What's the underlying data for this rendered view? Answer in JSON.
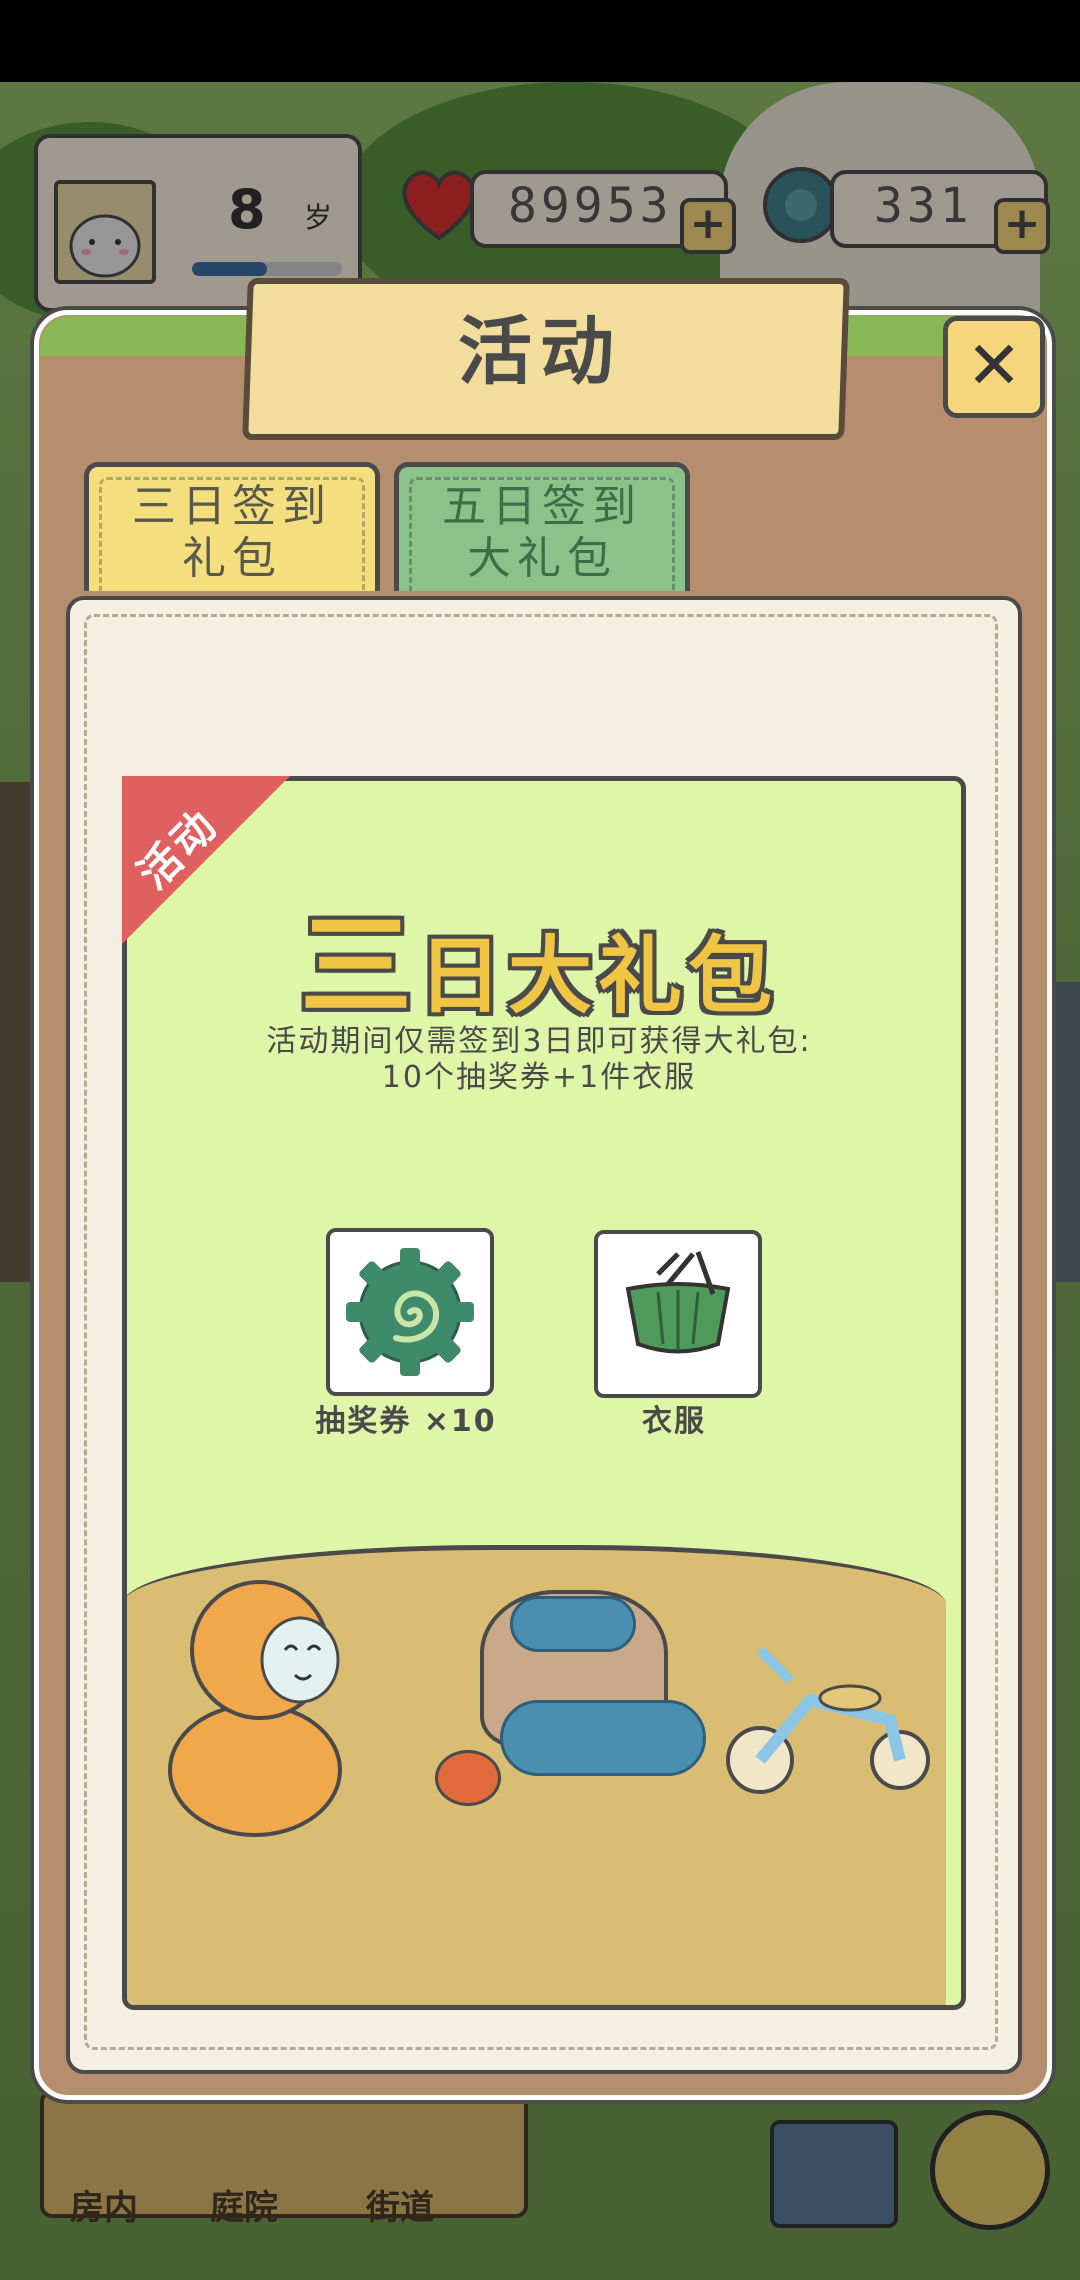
{
  "hud": {
    "age_value": "8",
    "age_unit": "岁",
    "hearts": "89953",
    "clovers": "331",
    "plus": "+"
  },
  "dialog": {
    "title": "活动",
    "close": "✕",
    "tabs": [
      {
        "line1": "三日签到",
        "line2": "礼包"
      },
      {
        "line1": "五日签到",
        "line2": "大礼包"
      }
    ],
    "ribbon": "活动",
    "event_title_first": "三",
    "event_title_rest": "日大礼包",
    "description_line1": "活动期间仅需签到3日即可获得大礼包:",
    "description_line2": "10个抽奖券+1件衣服",
    "rewards": [
      {
        "label": "抽奖券 ×10",
        "icon": "ticket-icon"
      },
      {
        "label": "衣服",
        "icon": "clothes-icon"
      }
    ]
  },
  "bottom_nav": {
    "items": [
      {
        "label": "房内"
      },
      {
        "label": "庭院"
      },
      {
        "label": "街道"
      }
    ]
  },
  "colors": {
    "panel": "#b58f6d",
    "event_bg": "#dff5a8",
    "ribbon": "#e06060",
    "tab_active": "#f5de7e",
    "tab_inactive": "#8bc28a"
  }
}
